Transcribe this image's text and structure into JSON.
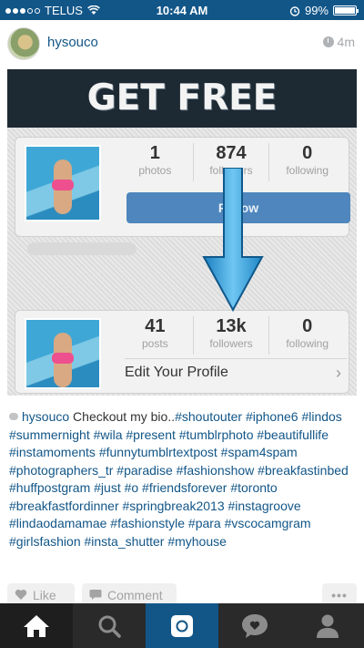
{
  "status_bar": {
    "carrier": "TELUS",
    "time": "10:44 AM",
    "battery": "99%",
    "battery_level": 0.99,
    "signal_bars": 3
  },
  "post": {
    "username": "hysouco",
    "time_ago": "4m",
    "image": {
      "banner": "GET FREE FOLLOWERS",
      "before": {
        "stats": [
          {
            "value": "1",
            "label": "photos"
          },
          {
            "value": "874",
            "label": "followers"
          },
          {
            "value": "0",
            "label": "following"
          }
        ],
        "button": "Follow"
      },
      "after": {
        "stats": [
          {
            "value": "41",
            "label": "posts"
          },
          {
            "value": "13k",
            "label": "followers"
          },
          {
            "value": "0",
            "label": "following"
          }
        ],
        "edit_label": "Edit Your Profile"
      }
    },
    "caption": {
      "username": "hysouco",
      "text": "Checkout my bio..",
      "tags": "#shoutouter #iphone6 #lindos #summernight #wila #present #tumblrphoto #beautifullife #instamoments #funnytumblrtextpost #spam4spam #photographers_tr #paradise #fashionshow #breakfastinbed #huffpostgram #just #o #friendsforever #toronto #breakfastfordinner #springbreak2013 #instagroove #lindaodamamae #fashionstyle #para #vscocamgram #girlsfashion #insta_shutter #myhouse"
    },
    "actions": {
      "like": "Like",
      "comment": "Comment",
      "more": "•••"
    }
  },
  "tab_bar": {
    "tabs": [
      "home-icon",
      "search-icon",
      "camera-icon",
      "activity-icon",
      "profile-icon"
    ],
    "active": "home"
  },
  "colors": {
    "brand": "#125688",
    "tab_bar": "#2a2a2a"
  }
}
